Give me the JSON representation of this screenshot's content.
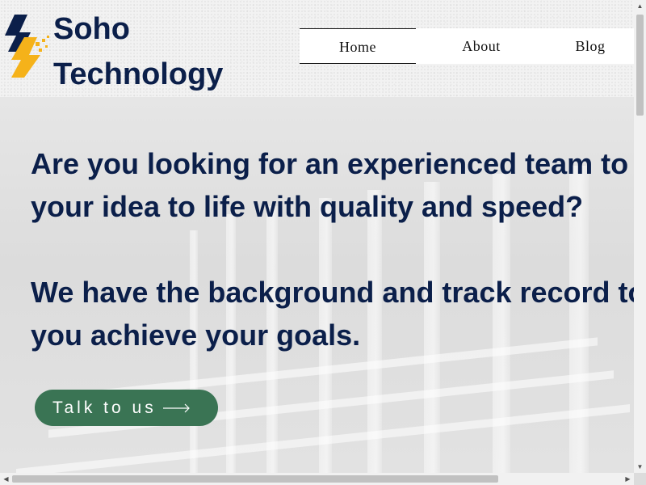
{
  "header": {
    "brand_line1": "Soho",
    "brand_line2": "Technology",
    "logo_icon": "soho-logo-icon",
    "nav": [
      {
        "label": "Home",
        "active": true
      },
      {
        "label": "About",
        "active": false
      },
      {
        "label": "Blog",
        "active": false
      }
    ]
  },
  "hero": {
    "line1": "Are you looking for an experienced team to bring",
    "line2": "your idea to life with quality and speed?",
    "line3": "We have the background and track record to help",
    "line4": "you achieve your goals.",
    "cta_label": "Talk to us",
    "cta_icon": "arrow-right-icon"
  },
  "colors": {
    "brand_navy": "#0b1f4a",
    "cta_green": "#3a7454",
    "logo_yellow": "#f5b21a"
  }
}
